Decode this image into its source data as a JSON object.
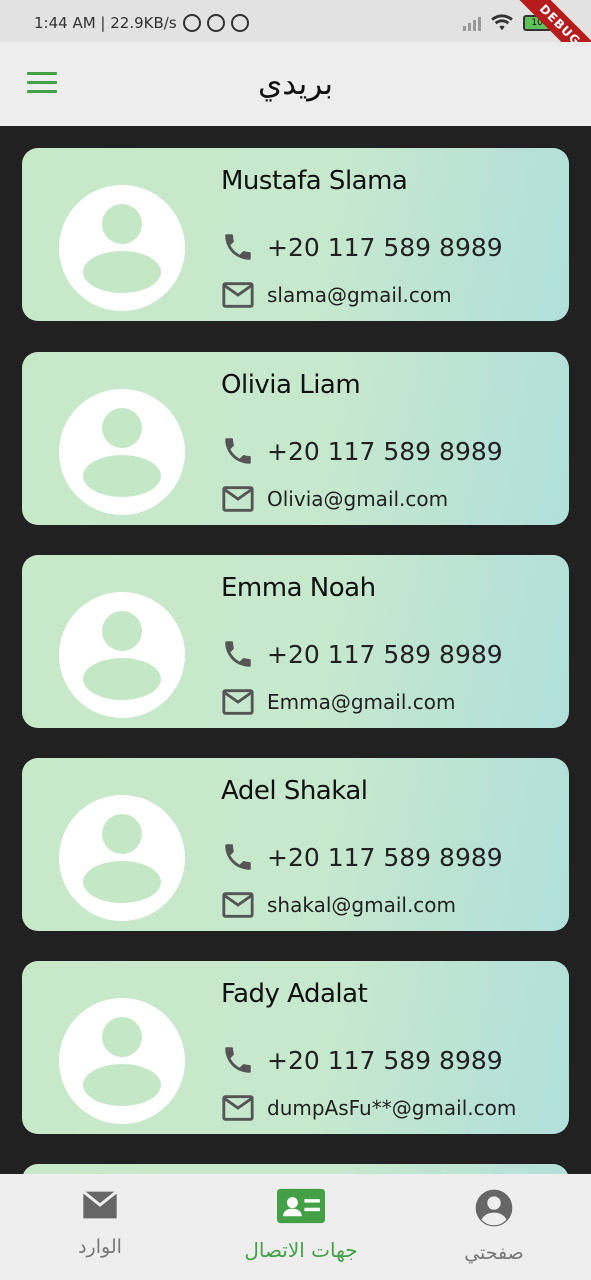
{
  "status_bar": {
    "text": "1:44 AM | 22.9KB/s",
    "battery": "100",
    "debug_banner": "DEBUG"
  },
  "app_bar": {
    "title": "بريدي",
    "menu_icon": "hamburger-menu-icon",
    "accent_color": "#43a047"
  },
  "contacts": [
    {
      "name": "Mustafa Slama",
      "phone": "+20 117 589 8989",
      "email": "slama@gmail.com"
    },
    {
      "name": "Olivia Liam",
      "phone": "+20 117 589 8989",
      "email": "Olivia@gmail.com"
    },
    {
      "name": "Emma Noah",
      "phone": "+20 117 589 8989",
      "email": "Emma@gmail.com"
    },
    {
      "name": "Adel Shakal",
      "phone": "+20 117 589 8989",
      "email": "shakal@gmail.com"
    },
    {
      "name": "Fady Adalat",
      "phone": "+20 117 589 8989",
      "email": "dumpAsFu**@gmail.com"
    },
    {
      "name": "",
      "phone": "",
      "email": ""
    }
  ],
  "bottom_nav": {
    "items": [
      {
        "label": "الوارد",
        "icon": "mail-icon",
        "active": false
      },
      {
        "label": "جهات الاتصال",
        "icon": "contact-card-icon",
        "active": true
      },
      {
        "label": "صفحتي",
        "icon": "account-circle-icon",
        "active": false
      }
    ]
  }
}
